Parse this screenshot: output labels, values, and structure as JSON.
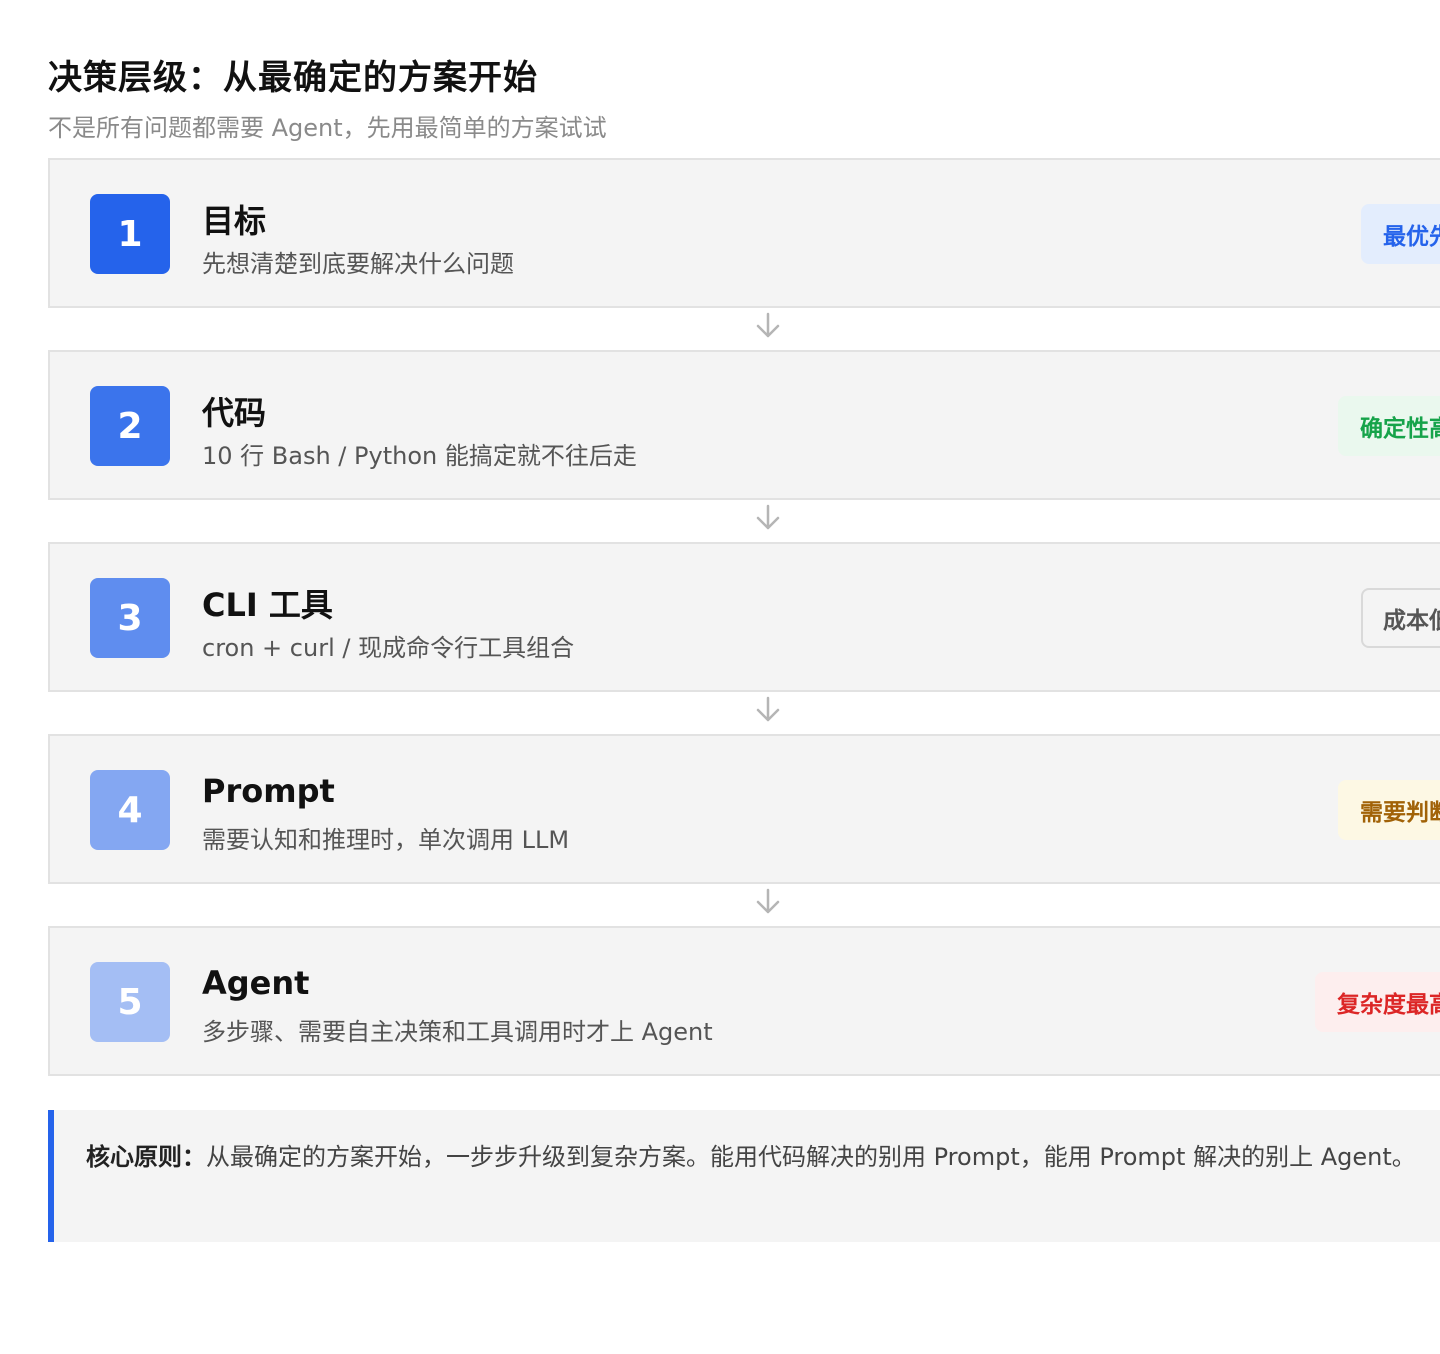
{
  "header": {
    "title": "决策层级：从最确定的方案开始",
    "subtitle": "不是所有问题都需要 Agent，先用最简单的方案试试"
  },
  "levels": [
    {
      "num": "1",
      "name": "目标",
      "desc": "先想清楚到底要解决什么问题",
      "tag": "最优先",
      "badge_color": "#2563eb",
      "tag_color": "#2563eb",
      "tag_bg": "#e3edfd",
      "tag_border": "#e3edfd"
    },
    {
      "num": "2",
      "name": "代码",
      "desc": "10 行 Bash / Python 能搞定就不往后走",
      "tag": "确定性高",
      "badge_color": "#3b74ec",
      "tag_color": "#16a34a",
      "tag_bg": "#eaf8ee",
      "tag_border": "#eaf8ee"
    },
    {
      "num": "3",
      "name": "CLI 工具",
      "desc": "cron + curl / 现成命令行工具组合",
      "tag": "成本低",
      "badge_color": "#5f8def",
      "tag_color": "#555555",
      "tag_bg": "#f4f4f4",
      "tag_border": "#d9d9d9"
    },
    {
      "num": "4",
      "name": "Prompt",
      "desc": "需要认知和推理时，单次调用 LLM",
      "tag": "需要判断",
      "badge_color": "#84a7f2",
      "tag_color": "#a16207",
      "tag_bg": "#fdf8e4",
      "tag_border": "#fdf8e4"
    },
    {
      "num": "5",
      "name": "Agent",
      "desc": "多步骤、需要自主决策和工具调用时才上 Agent",
      "tag": "复杂度最高",
      "badge_color": "#a4bef4",
      "tag_color": "#dc2626",
      "tag_bg": "#fdeeee",
      "tag_border": "#fdeeee"
    }
  ],
  "icons": {
    "arrow": "arrow-down-icon"
  },
  "note": {
    "label": "核心原则：",
    "text": "从最确定的方案开始，一步步升级到复杂方案。能用代码解决的别用 Prompt，能用 Prompt 解决的别上 Agent。",
    "accent": "#2563eb"
  }
}
